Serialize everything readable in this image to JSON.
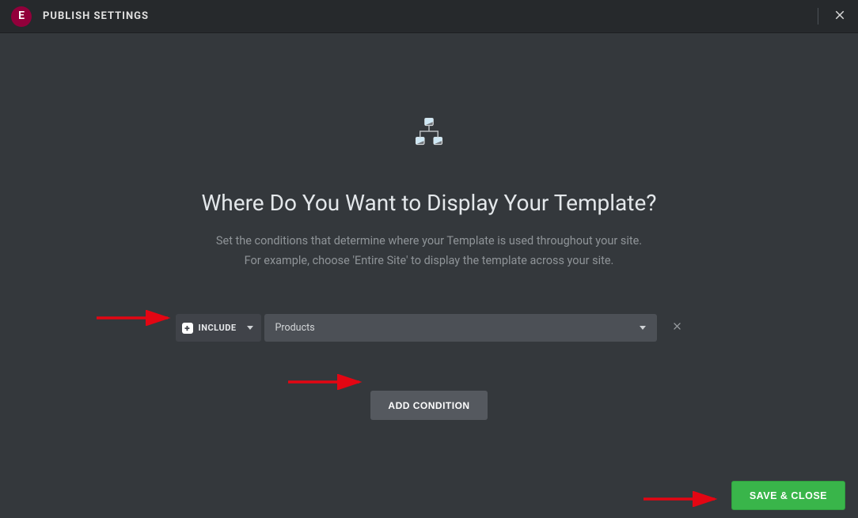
{
  "header": {
    "title": "PUBLISH SETTINGS",
    "logo_text": "E"
  },
  "main": {
    "heading": "Where Do You Want to Display Your Template?",
    "description": "Set the conditions that determine where your Template is used throughout your site.\nFor example, choose 'Entire Site' to display the template across your site."
  },
  "condition": {
    "mode": "INCLUDE",
    "target": "Products"
  },
  "buttons": {
    "add_condition": "ADD CONDITION",
    "save_close": "SAVE & CLOSE"
  },
  "icons": {
    "plus": "+"
  }
}
